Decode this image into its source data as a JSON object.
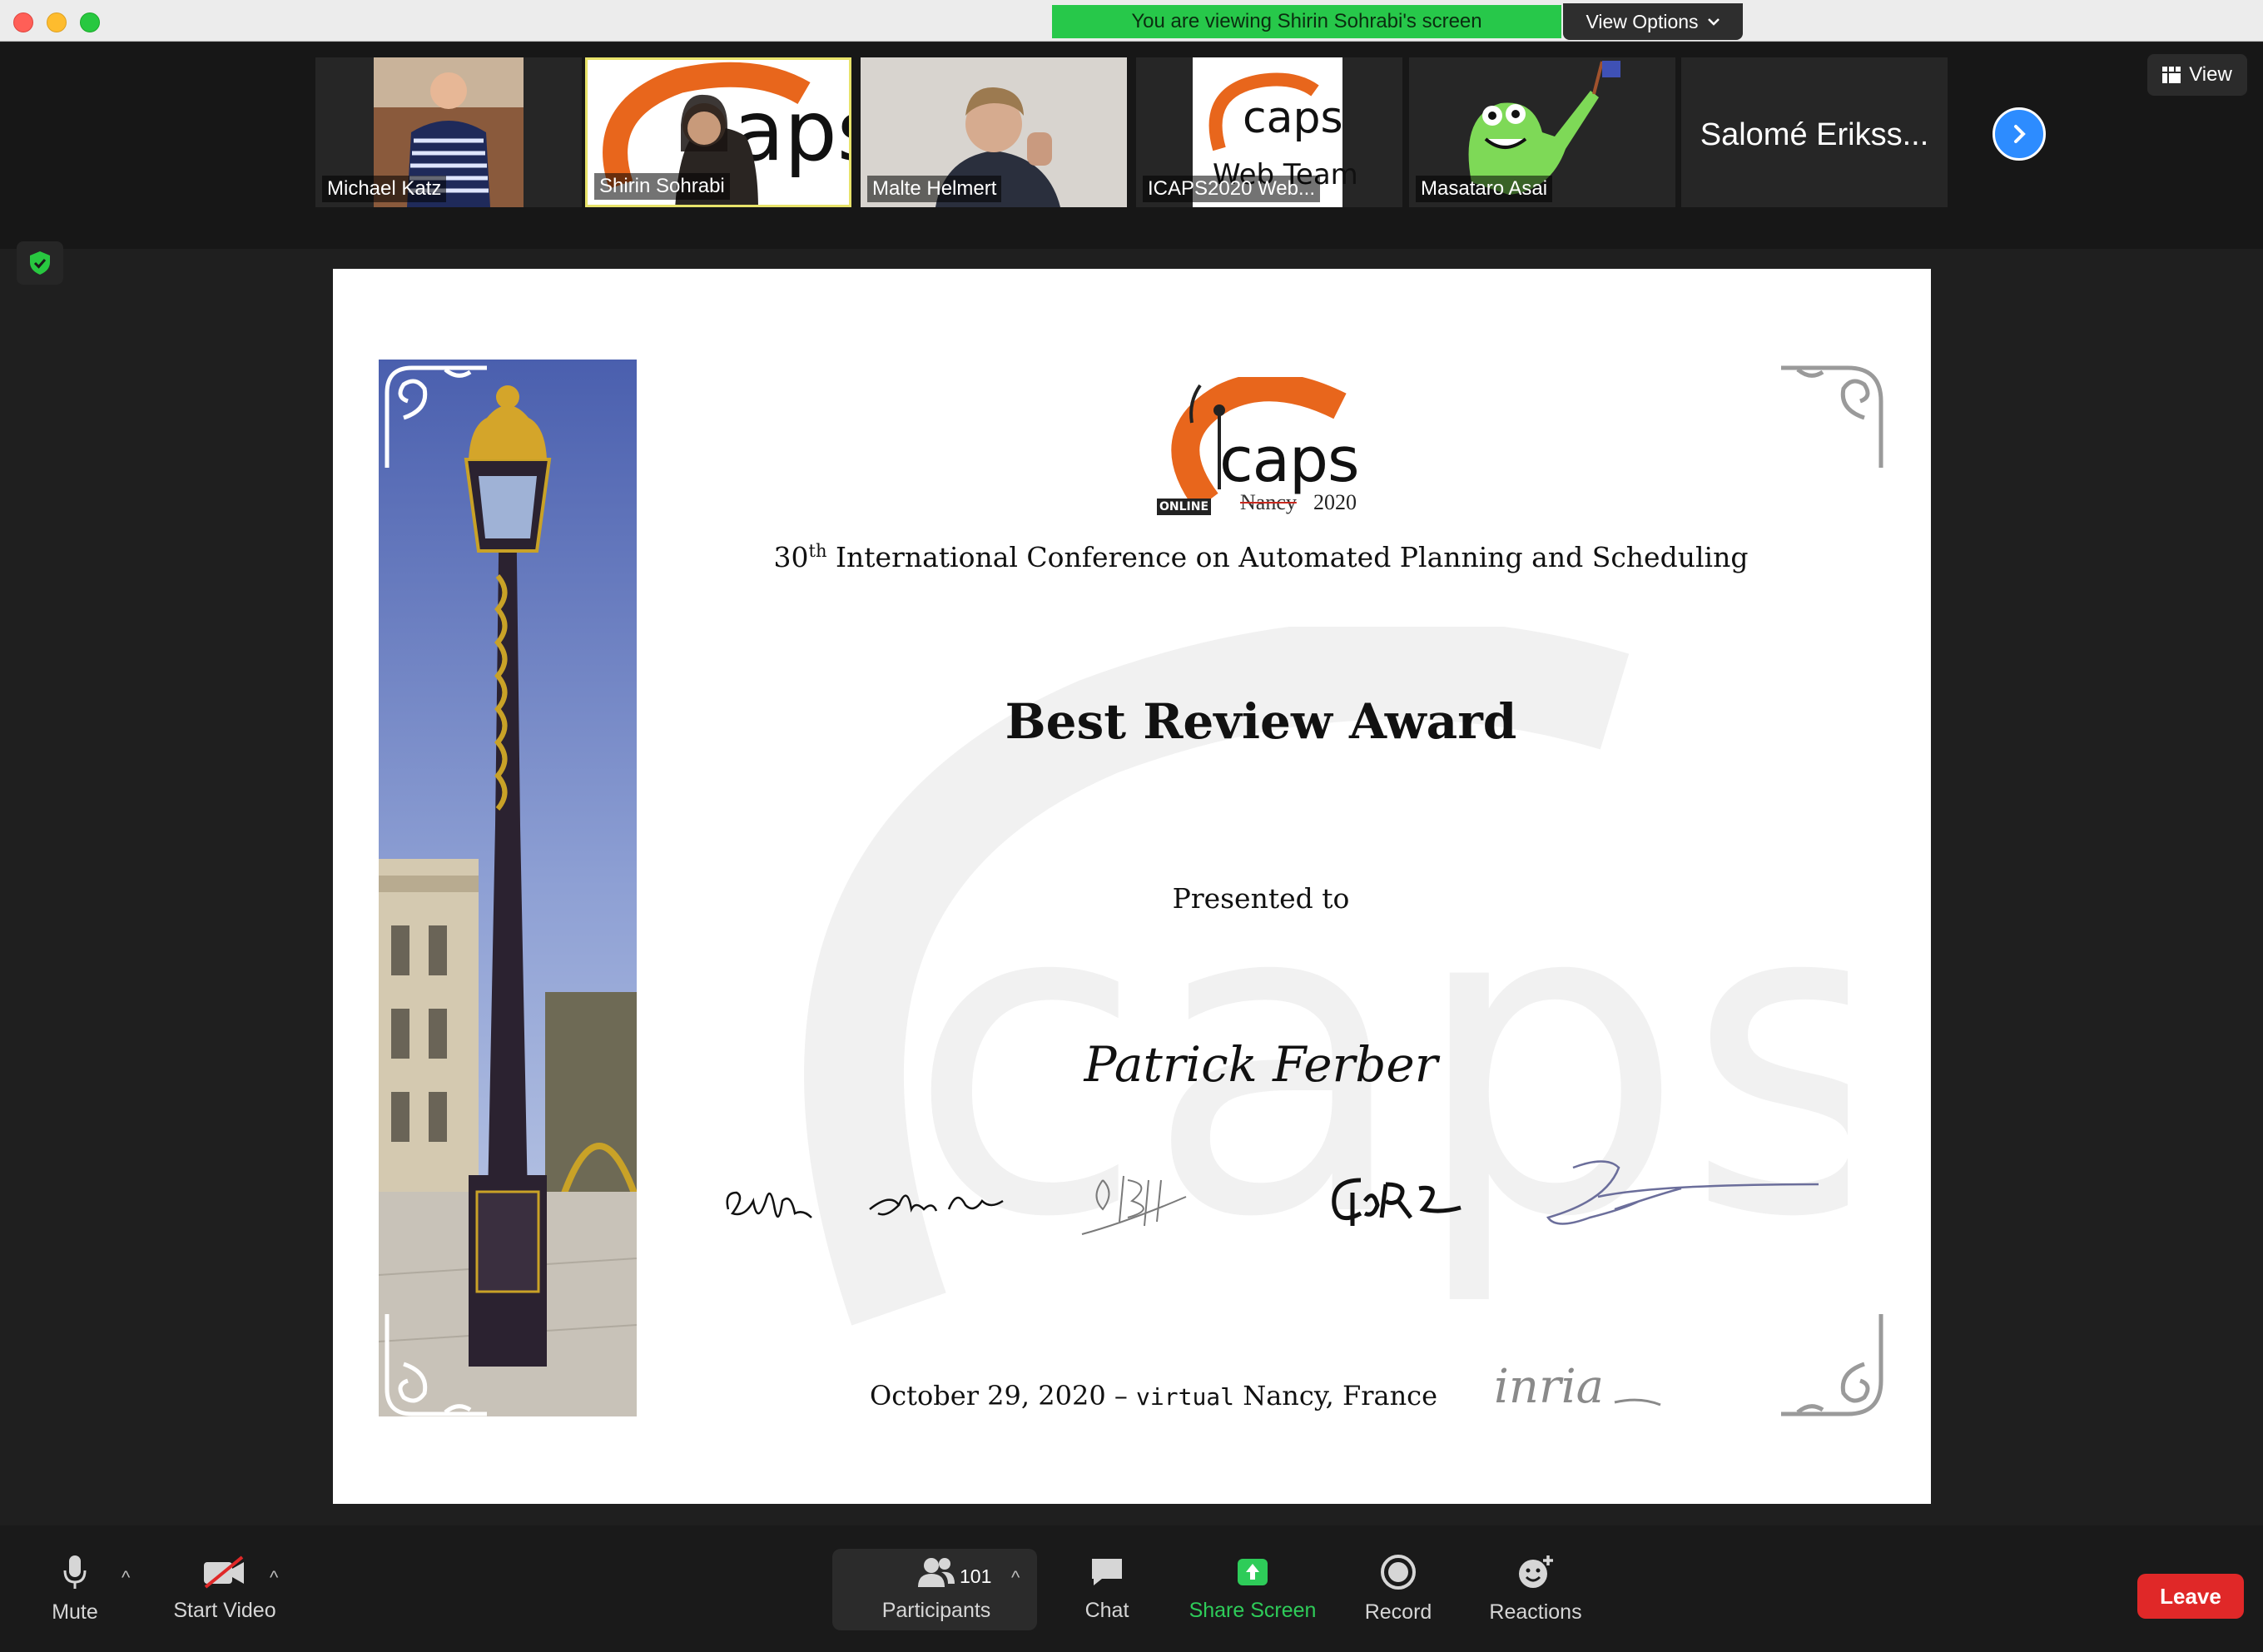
{
  "window": {
    "banner_text": "You are viewing Shirin Sohrabi's screen",
    "view_options_label": "View Options",
    "view_button_label": "View"
  },
  "participants": [
    {
      "name": "Michael Katz"
    },
    {
      "name": "Shirin Sohrabi"
    },
    {
      "name": "Malte Helmert"
    },
    {
      "name": "ICAPS2020 Web..."
    },
    {
      "name": "Masataro Asai"
    },
    {
      "name": "Salomé Erikss..."
    }
  ],
  "certificate": {
    "logo_text": "caps",
    "logo_online": "ONLINE",
    "logo_nancy": "Nancy",
    "logo_year": "2020",
    "conference_ordinal": "30",
    "conference_ordinal_suffix": "th",
    "conference_name": "International Conference on Automated Planning and Scheduling",
    "award_title": "Best Review Award",
    "presented_to": "Presented to",
    "recipient": "Patrick Ferber",
    "date": "October 29, 2020",
    "date_separator": "–",
    "virtual_word": "virtual",
    "location": "Nancy, France",
    "sponsor_logo_text": "inria"
  },
  "toolbar": {
    "mute_label": "Mute",
    "start_video_label": "Start Video",
    "participants_label": "Participants",
    "participants_count": "101",
    "chat_label": "Chat",
    "share_screen_label": "Share Screen",
    "record_label": "Record",
    "reactions_label": "Reactions",
    "leave_label": "Leave"
  },
  "colors": {
    "banner_green": "#27c84a",
    "share_green": "#2ecc59",
    "leave_red": "#e02828",
    "next_blue": "#2d8cff",
    "icaps_orange": "#e8661c"
  },
  "icons": [
    "mic-icon",
    "video-off-icon",
    "participants-icon",
    "chat-icon",
    "share-screen-icon",
    "record-icon",
    "reactions-icon",
    "shield-icon",
    "chevron-right-icon",
    "grid-icon"
  ]
}
